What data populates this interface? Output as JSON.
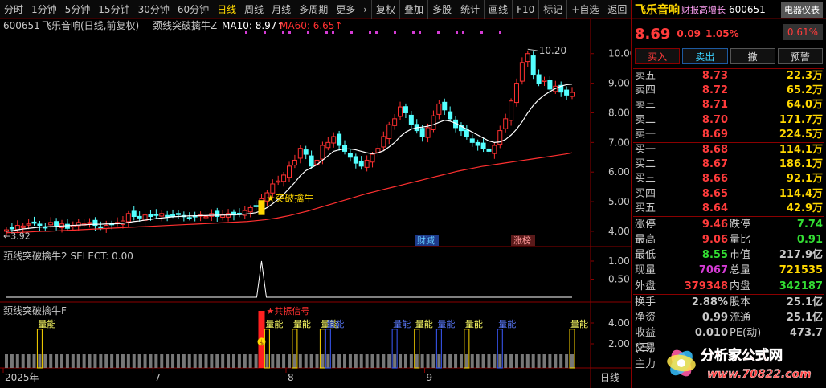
{
  "toolbar": {
    "periods": [
      "分时",
      "1分钟",
      "5分钟",
      "15分钟",
      "30分钟",
      "60分钟",
      "日线",
      "周线",
      "月线",
      "多周期",
      "更多"
    ],
    "active_period": "日线",
    "buttons": [
      "复权",
      "叠加",
      "多股",
      "统计",
      "画线",
      "F10",
      "标记",
      "+自选",
      "返回"
    ]
  },
  "main_panel": {
    "code": "600651",
    "name_full": "飞乐音响(日线,前复权)",
    "indicator": "颈线突破擒牛Z",
    "ma10_label": "MA10: 8.97",
    "ma60_label": "MA60: 6.65",
    "ma10_color": "#ffffff",
    "ma60_color": "#ff3030",
    "max_label": "10.20",
    "min_label": "3.92",
    "signal_label": "突破擒牛",
    "event_labels": [
      "财减",
      "涨榜"
    ],
    "y_axis_ticks": [
      "10.00",
      "9.00",
      "8.00",
      "7.00",
      "6.00",
      "5.00",
      "4.00"
    ]
  },
  "panel2": {
    "title": "颈线突破擒牛2",
    "select_label": "SELECT: 0.00",
    "y_axis_ticks": [
      "1.00",
      "0.50"
    ]
  },
  "panel3": {
    "title": "颈线突破擒牛F",
    "signal_text": "共振信号",
    "coin_label": "$",
    "bar_labels": [
      "量能",
      "量能",
      "量能",
      "量能",
      "量能",
      "量能",
      "量能"
    ],
    "blue_labels": [
      "量能",
      "量能",
      "量能",
      "量能"
    ],
    "y_axis_ticks": [
      "4.00",
      "2.00"
    ]
  },
  "x_axis": {
    "labels": [
      "2025年",
      "7",
      "8",
      "9"
    ],
    "period_label": "日线"
  },
  "quote": {
    "name": "飞乐音响",
    "tag": "财报高增长",
    "code": "600651",
    "indicator_btn": "电器仪表",
    "price": "8.69",
    "change": "0.09",
    "pct": "1.05%",
    "pct_box": "0.61%",
    "actions": [
      "买入",
      "卖出",
      "撤",
      "预警"
    ],
    "asks": [
      {
        "label": "卖五",
        "price": "8.73",
        "vol": "22.3万"
      },
      {
        "label": "卖四",
        "price": "8.72",
        "vol": "65.2万"
      },
      {
        "label": "卖三",
        "price": "8.71",
        "vol": "64.0万"
      },
      {
        "label": "卖二",
        "price": "8.70",
        "vol": "171.7万"
      },
      {
        "label": "卖一",
        "price": "8.69",
        "vol": "224.5万"
      }
    ],
    "bids": [
      {
        "label": "买一",
        "price": "8.68",
        "vol": "114.1万"
      },
      {
        "label": "买二",
        "price": "8.67",
        "vol": "186.1万"
      },
      {
        "label": "买三",
        "price": "8.66",
        "vol": "92.1万"
      },
      {
        "label": "买四",
        "price": "8.65",
        "vol": "114.4万"
      },
      {
        "label": "买五",
        "price": "8.64",
        "vol": "42.9万"
      }
    ],
    "stats": [
      {
        "l1": "涨停",
        "v1": "9.46",
        "c1": "#ff3b3b",
        "l2": "跌停",
        "v2": "7.74",
        "c2": "#33dd33"
      },
      {
        "l1": "最高",
        "v1": "9.06",
        "c1": "#ff3b3b",
        "l2": "量比",
        "v2": "0.91",
        "c2": "#33dd33"
      },
      {
        "l1": "最低",
        "v1": "8.55",
        "c1": "#33dd33",
        "l2": "市值",
        "v2": "217.9亿",
        "c2": "#c8c8c8"
      },
      {
        "l1": "现量",
        "v1": "7067",
        "c1": "#d43bd4",
        "l2": "总量",
        "v2": "721535",
        "c2": "#ffd700"
      },
      {
        "l1": "外盘",
        "v1": "379348",
        "c1": "#ff3b3b",
        "l2": "内盘",
        "v2": "342187",
        "c2": "#33dd33"
      }
    ],
    "stats2": [
      {
        "l1": "换手",
        "v1": "2.88%",
        "c1": "#c8c8c8",
        "l2": "股本",
        "v2": "25.1亿",
        "c2": "#c8c8c8"
      },
      {
        "l1": "净资",
        "v1": "0.99",
        "c1": "#c8c8c8",
        "l2": "流通",
        "v2": "25.1亿",
        "c2": "#c8c8c8"
      },
      {
        "l1": "收益(三)",
        "v1": "0.010",
        "c1": "#c8c8c8",
        "l2": "PE(动)",
        "v2": "473.7",
        "c2": "#c8c8c8"
      }
    ],
    "footer_labels": [
      "交易",
      "主力"
    ]
  },
  "watermark": {
    "title": "分析家公式网",
    "url": "www.70822.com"
  },
  "chart_data": {
    "type": "candlestick",
    "ohlc_close": [
      4.05,
      4.08,
      4.2,
      4.18,
      4.25,
      4.3,
      4.2,
      4.15,
      4.3,
      4.2,
      4.25,
      4.1,
      4.2,
      4.3,
      4.25,
      4.3,
      4.2,
      4.15,
      4.2,
      4.25,
      4.3,
      4.35,
      4.6,
      4.5,
      4.45,
      4.55,
      4.5,
      4.55,
      4.6,
      4.5,
      4.55,
      4.6,
      4.5,
      4.45,
      4.5,
      4.55,
      4.5,
      4.6,
      4.5,
      4.55,
      4.6,
      4.55,
      4.6,
      4.7,
      4.8,
      4.85,
      5.1,
      5.3,
      5.6,
      5.7,
      5.9,
      6.2,
      6.4,
      6.8,
      6.6,
      6.2,
      6.4,
      6.9,
      7.0,
      7.2,
      6.9,
      6.7,
      6.5,
      6.3,
      6.2,
      6.4,
      6.6,
      6.8,
      7.2,
      7.6,
      7.8,
      8.2,
      8.0,
      7.6,
      7.4,
      7.2,
      7.5,
      7.9,
      8.3,
      8.1,
      7.8,
      7.5,
      7.4,
      7.2,
      7.0,
      6.9,
      6.8,
      6.7,
      6.9,
      7.4,
      7.8,
      8.4,
      9.0,
      9.7,
      10.0,
      9.3,
      9.0,
      9.1,
      8.8,
      8.9,
      8.7,
      8.6,
      8.69
    ],
    "ma10": [
      4.0,
      4.02,
      4.05,
      4.08,
      4.1,
      4.12,
      4.14,
      4.15,
      4.16,
      4.17,
      4.18,
      4.19,
      4.2,
      4.21,
      4.22,
      4.23,
      4.24,
      4.24,
      4.25,
      4.25,
      4.26,
      4.27,
      4.3,
      4.33,
      4.35,
      4.38,
      4.4,
      4.43,
      4.45,
      4.47,
      4.49,
      4.5,
      4.51,
      4.52,
      4.52,
      4.53,
      4.53,
      4.54,
      4.54,
      4.55,
      4.55,
      4.56,
      4.56,
      4.58,
      4.6,
      4.63,
      4.7,
      4.8,
      4.93,
      5.08,
      5.25,
      5.45,
      5.65,
      5.88,
      6.05,
      6.15,
      6.25,
      6.4,
      6.55,
      6.7,
      6.75,
      6.78,
      6.78,
      6.75,
      6.7,
      6.65,
      6.62,
      6.65,
      6.72,
      6.85,
      7.0,
      7.2,
      7.35,
      7.45,
      7.5,
      7.52,
      7.55,
      7.6,
      7.68,
      7.75,
      7.72,
      7.65,
      7.55,
      7.45,
      7.35,
      7.25,
      7.15,
      7.05,
      7.0,
      7.02,
      7.1,
      7.25,
      7.45,
      7.7,
      8.0,
      8.25,
      8.45,
      8.6,
      8.72,
      8.82,
      8.9,
      8.95,
      8.97
    ],
    "ma60": [
      3.95,
      3.96,
      3.96,
      3.97,
      3.98,
      3.99,
      4.0,
      4.0,
      4.01,
      4.02,
      4.03,
      4.04,
      4.05,
      4.06,
      4.07,
      4.08,
      4.09,
      4.1,
      4.11,
      4.12,
      4.13,
      4.14,
      4.15,
      4.16,
      4.17,
      4.18,
      4.19,
      4.2,
      4.21,
      4.22,
      4.23,
      4.24,
      4.25,
      4.26,
      4.27,
      4.28,
      4.29,
      4.3,
      4.31,
      4.32,
      4.33,
      4.35,
      4.37,
      4.39,
      4.42,
      4.45,
      4.49,
      4.53,
      4.58,
      4.63,
      4.68,
      4.74,
      4.8,
      4.86,
      4.92,
      4.98,
      5.04,
      5.1,
      5.16,
      5.22,
      5.28,
      5.33,
      5.38,
      5.43,
      5.48,
      5.53,
      5.58,
      5.63,
      5.68,
      5.73,
      5.78,
      5.83,
      5.88,
      5.93,
      5.98,
      6.03,
      6.07,
      6.11,
      6.15,
      6.19,
      6.22,
      6.25,
      6.28,
      6.31,
      6.34,
      6.37,
      6.4,
      6.43,
      6.46,
      6.49,
      6.52,
      6.55,
      6.58,
      6.61,
      6.65
    ],
    "y_range": [
      3.7,
      10.4
    ]
  }
}
